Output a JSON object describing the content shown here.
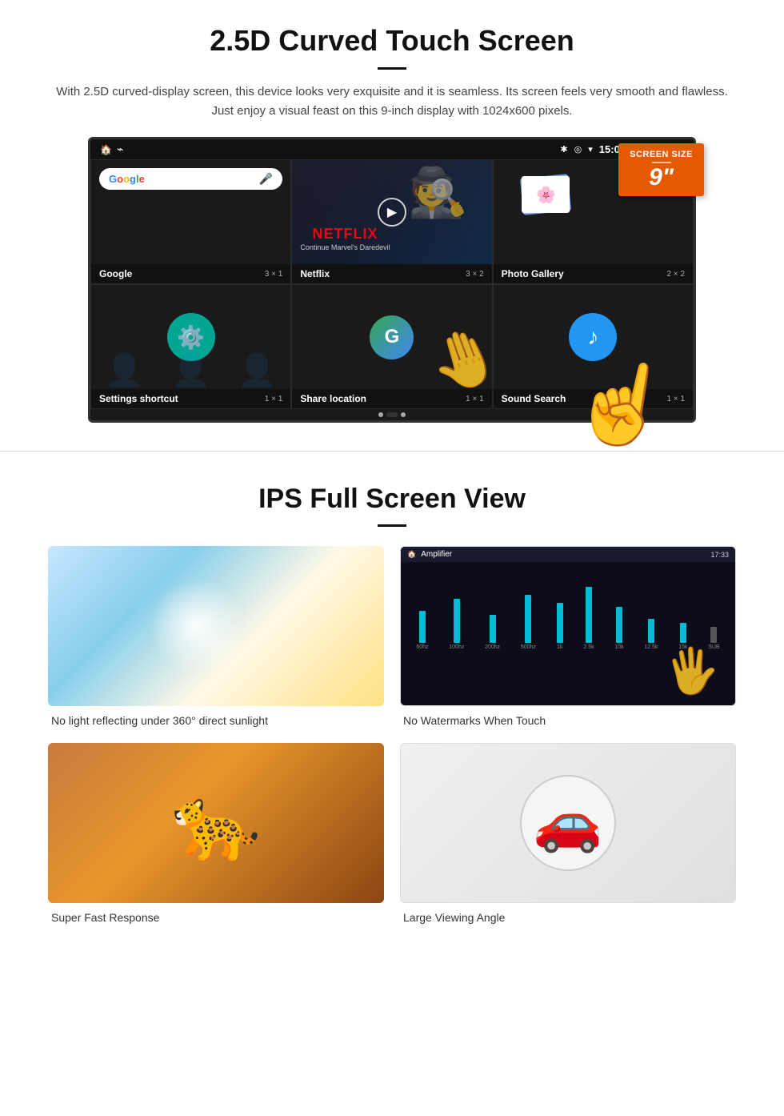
{
  "section1": {
    "title": "2.5D Curved Touch Screen",
    "description": "With 2.5D curved-display screen, this device looks very exquisite and it is seamless. Its screen feels very smooth and flawless. Just enjoy a visual feast on this 9-inch display with 1024x600 pixels.",
    "badge": {
      "label": "Screen Size",
      "size": "9\""
    },
    "statusBar": {
      "time": "15:06"
    },
    "apps": [
      {
        "name": "Google",
        "size": "3 × 1"
      },
      {
        "name": "Netflix",
        "size": "3 × 2",
        "subtitle": "Continue Marvel's Daredevil"
      },
      {
        "name": "Photo Gallery",
        "size": "2 × 2"
      },
      {
        "name": "Settings shortcut",
        "size": "1 × 1"
      },
      {
        "name": "Share location",
        "size": "1 × 1"
      },
      {
        "name": "Sound Search",
        "size": "1 × 1"
      }
    ]
  },
  "section2": {
    "title": "IPS Full Screen View",
    "features": [
      {
        "id": "sunlight",
        "caption": "No light reflecting under 360° direct sunlight"
      },
      {
        "id": "equalizer",
        "caption": "No Watermarks When Touch"
      },
      {
        "id": "cheetah",
        "caption": "Super Fast Response"
      },
      {
        "id": "car",
        "caption": "Large Viewing Angle"
      }
    ]
  }
}
